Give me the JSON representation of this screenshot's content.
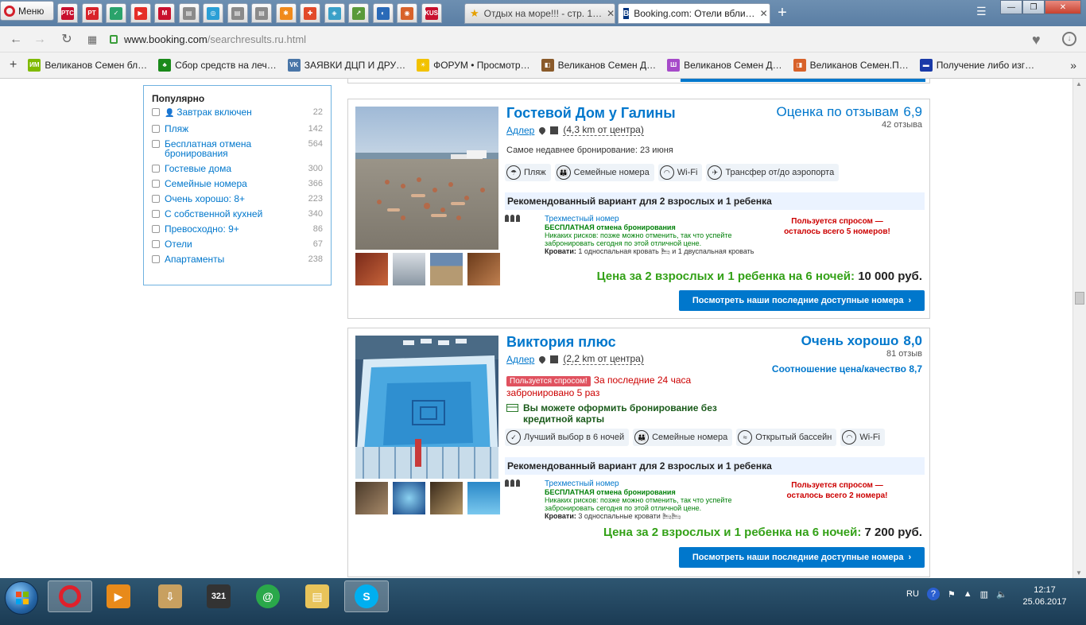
{
  "browser": {
    "menu_label": "Меню",
    "pinned_tabs": [
      {
        "text": "РТС",
        "color": "#c8102e"
      },
      {
        "text": "PT",
        "color": "#d8232a"
      },
      {
        "text": "✓",
        "color": "#2aa36b"
      },
      {
        "text": "▶",
        "color": "#e52d27"
      },
      {
        "text": "M",
        "color": "#c8102e"
      },
      {
        "text": "▤",
        "color": "#8a8a8a"
      },
      {
        "text": "◎",
        "color": "#2a9fd6"
      },
      {
        "text": "▤",
        "color": "#8a8a8a"
      },
      {
        "text": "▤",
        "color": "#8a8a8a"
      },
      {
        "text": "✱",
        "color": "#f08a1c"
      },
      {
        "text": "✚",
        "color": "#e24a2a"
      },
      {
        "text": "◈",
        "color": "#3aa0c8"
      },
      {
        "text": "↗",
        "color": "#5a9a3a"
      },
      {
        "text": "◐",
        "color": "#2a6ab8"
      },
      {
        "text": "◉",
        "color": "#d8622a"
      },
      {
        "text": "KUS",
        "color": "#c8102e"
      }
    ],
    "tabs": [
      {
        "title": "Отдых на море!!! - стр. 1…",
        "close": "✕"
      },
      {
        "title": "Booking.com: Отели вбли…",
        "close": "✕"
      }
    ],
    "new_tab": "+",
    "window_buttons": {
      "minimize": "—",
      "maximize": "❐",
      "close": "✕"
    },
    "url_host": "www.booking.com",
    "url_path": "/searchresults.ru.html",
    "bookmarks": [
      {
        "label": "Великанов Семен бл…",
        "color": "#7fba00",
        "text": "ИМ"
      },
      {
        "label": "Сбор средств на леч…",
        "color": "#1a8a1a",
        "text": "♣"
      },
      {
        "label": "ЗАЯВКИ ДЦП И ДРУ…",
        "color": "#4a76a8",
        "text": "VK"
      },
      {
        "label": "ФОРУМ • Просмотр…",
        "color": "#f2c200",
        "text": "☀"
      },
      {
        "label": "Великанов Семен Д…",
        "color": "#8a5a2a",
        "text": "◧"
      },
      {
        "label": "Великанов Семен Д…",
        "color": "#a64ac9",
        "text": "Ш"
      },
      {
        "label": "Великанов Семен.П…",
        "color": "#d8622a",
        "text": "◨"
      },
      {
        "label": "Получение либо изг…",
        "color": "#1a3aa8",
        "text": "▬"
      }
    ],
    "bookmarks_more": "»"
  },
  "filter": {
    "title": "Популярно",
    "items": [
      {
        "label": "Завтрак включен",
        "count": "22",
        "icon": true
      },
      {
        "label": "Пляж",
        "count": "142"
      },
      {
        "label": "Бесплатная отмена бронирования",
        "count": "564"
      },
      {
        "label": "Гостевые дома",
        "count": "300"
      },
      {
        "label": "Семейные номера",
        "count": "366"
      },
      {
        "label": "Очень хорошо: 8+",
        "count": "223"
      },
      {
        "label": "С собственной кухней",
        "count": "340"
      },
      {
        "label": "Превосходно: 9+",
        "count": "86"
      },
      {
        "label": "Отели",
        "count": "67"
      },
      {
        "label": "Апартаменты",
        "count": "238"
      }
    ]
  },
  "hotels": [
    {
      "name": "Гостевой Дом у Галины",
      "city": "Адлер",
      "distance": "(4,3 km от центра)",
      "score_label": "Оценка по отзывам",
      "score": "6,9",
      "reviews": "42 отзыва",
      "recent": "Самое недавнее бронирование: 23 июня",
      "facilities": [
        "Пляж",
        "Семейные номера",
        "Wi-Fi",
        "Трансфер от/до аэропорта"
      ],
      "rec_title": "Рекомендованный вариант для 2 взрослых и 1 ребенка",
      "room_name": "Трехместный номер",
      "room_free": "БЕСПЛАТНАЯ отмена бронирования",
      "room_risk": "Никаких рисков: позже можно отменить, так что успейте забронировать сегодня по этой отличной цене.",
      "beds_label": "Кровати:",
      "beds": "1 односпальная кровать 🛏 и 1 двуспальная кровать",
      "demand": "Пользуется спросом — осталось всего 5 номеров!",
      "price_label": "Цена за 2 взрослых и 1 ребенка на 6 ночей:",
      "price": "10 000 руб.",
      "button": "Посмотреть наши последние доступные номера",
      "chevron": "›"
    },
    {
      "name": "Виктория плюс",
      "city": "Адлер",
      "distance": "(2,2 km от центра)",
      "score_label": "Очень хорошо",
      "score": "8,0",
      "reviews": "81 отзыв",
      "value_label": "Соотношение цена/качество",
      "value_score": "8,7",
      "urgency_badge": "Пользуется спросом!",
      "urgency_text": "За последние 24 часа забронировано 5 раз",
      "nocard": "Вы можете оформить бронирование без кредитной карты",
      "facilities": [
        "Лучший выбор в 6 ночей",
        "Семейные номера",
        "Открытый бассейн",
        "Wi-Fi"
      ],
      "rec_title": "Рекомендованный вариант для 2 взрослых и 1 ребенка",
      "room_name": "Трехместный номер",
      "room_free": "БЕСПЛАТНАЯ отмена бронирования",
      "room_risk": "Никаких рисков: позже можно отменить, так что успейте забронировать сегодня по этой отличной цене.",
      "beds_label": "Кровати:",
      "beds": "3 односпальные кровати",
      "demand": "Пользуется спросом — осталось всего 2 номера!",
      "price_label": "Цена за 2 взрослых и 1 ребенка на 6 ночей:",
      "price": "7 200 руб.",
      "button": "Посмотреть наши последние доступные номера",
      "chevron": "›"
    }
  ],
  "taskbar": {
    "lang": "RU",
    "help": "?",
    "time": "12:17",
    "date": "25.06.2017"
  }
}
